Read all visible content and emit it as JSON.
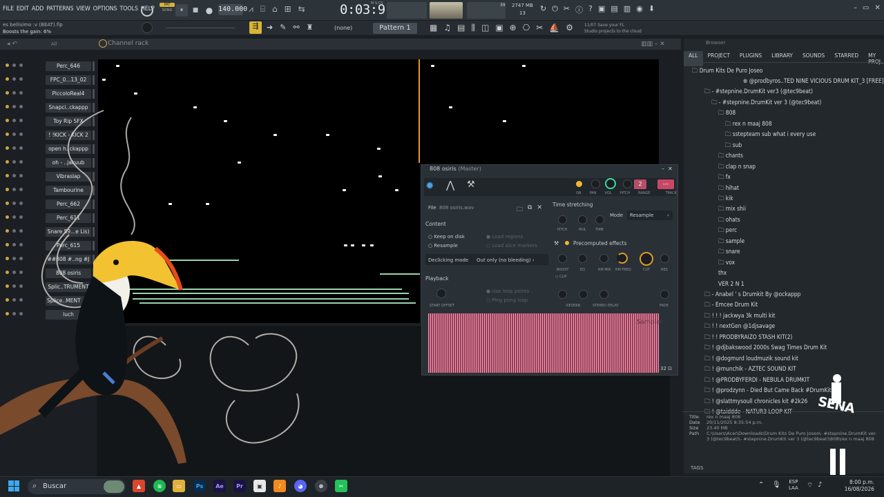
{
  "menu": [
    "FILE",
    "EDIT",
    "ADD",
    "PATTERNS",
    "VIEW",
    "OPTIONS",
    "TOOLS",
    "HELP"
  ],
  "song_mode": "PAT",
  "song_label": "SONG",
  "tempo": "140.000",
  "time": "0:03:91",
  "time_sub": "M:S:CS",
  "cpu_mem": "2747 MB",
  "cpu_cores": "39",
  "cpu_poly": "13",
  "hint_file": "es bellisimo :v (BEAT).flp",
  "hint_text": "Boosts the gain: 6%",
  "pattern_sel": "(none)",
  "pattern": "Pattern 1",
  "news": {
    "date": "11/07",
    "line1": "Save your FL",
    "line2": "Studio projects to the cloud"
  },
  "channel_rack": {
    "title": "Channel rack",
    "filter": "All",
    "channels": [
      "Perc_646",
      "FPC_0...13_02",
      "PiccoloReal4",
      "Snapci..ckappp",
      "Toy Rip SFX",
      "! !KICK - KICK 2",
      "open h..ckappp",
      "oh - ..jakuub",
      "Vibraslap",
      "Tambourine",
      "Perc_662",
      "Perc_611",
      "Snare 59...e Lis)",
      "Perc_615",
      "##808 #..ng #J",
      "808 osiris",
      "Splic..TRUMENT",
      "Splice..MENT #2",
      "luch"
    ]
  },
  "browser": {
    "title": "Browser",
    "tabs": [
      "ALL",
      "PROJECT",
      "PLUGINS",
      "LIBRARY",
      "SOUNDS",
      "STARRED",
      "MY PROJ..."
    ],
    "root": "Drum Kits De Puro Joseo",
    "items": [
      {
        "t": "@prodbyros..TED NINE VICIOUS DRUM KIT_3 [FREE]",
        "d": 4
      },
      {
        "t": "- #stepnine.DrumKit ver3 (@tec9beat)",
        "d": 1
      },
      {
        "t": "- #stepnine.DrumKit ver 3 (@tec9beat)",
        "d": 2
      },
      {
        "t": "808",
        "d": 3
      },
      {
        "t": "rex n maaj 808",
        "d": 4
      },
      {
        "t": "sstepteam sub what i every use",
        "d": 4
      },
      {
        "t": "sub",
        "d": 4
      },
      {
        "t": "chants",
        "d": 3
      },
      {
        "t": "clap n snap",
        "d": 3
      },
      {
        "t": "fx",
        "d": 3
      },
      {
        "t": "hihat",
        "d": 3
      },
      {
        "t": "kik",
        "d": 3
      },
      {
        "t": "mix shii",
        "d": 3
      },
      {
        "t": "ohats",
        "d": 3
      },
      {
        "t": "perc",
        "d": 3
      },
      {
        "t": "sample",
        "d": 3
      },
      {
        "t": "snare",
        "d": 3
      },
      {
        "t": "vox",
        "d": 3
      },
      {
        "t": "thx",
        "d": 3
      },
      {
        "t": "VER 2 N 1",
        "d": 3
      },
      {
        "t": "- Anabel ' s Drumkit By @ockappp",
        "d": 1
      },
      {
        "t": "- Emcee Drum Kit",
        "d": 1
      },
      {
        "t": "! ! ! jackwya 3k multi kit",
        "d": 1
      },
      {
        "t": "! ! nextGen @1djsavage",
        "d": 1
      },
      {
        "t": "! ! PRODBYRAIZO STASH KIT(2)",
        "d": 1
      },
      {
        "t": "! @djbakswood 2000s Swag Times Drum Kit",
        "d": 1
      },
      {
        "t": "! @dogmurd loudmuzik sound kit",
        "d": 1
      },
      {
        "t": "! @munchik - AZTEC SOUND KIT",
        "d": 1
      },
      {
        "t": "! @PRODBYFERDI - NEBULA DRUMKIT",
        "d": 1
      },
      {
        "t": "! @prodzynn - Died But Came Back #DrumKit",
        "d": 1
      },
      {
        "t": "! @slattmysoull chronicles kit #2k26",
        "d": 1
      },
      {
        "t": "! @taiddde - NATUR3 LOOP KIT",
        "d": 1
      }
    ],
    "info": {
      "title_label": "Title",
      "title": "rex n maaj 808",
      "date_label": "Date",
      "date": "20/11/2025 8:35:54 p.m.",
      "size_label": "Size",
      "size": "23.40 MB",
      "path_label": "Path",
      "path1": "C:\\Users\\Acer\\Downloads\\Drum Kits De Puro Joseo\\- #stepnine.DrumKit ver-",
      "path2": "3 (@tec9beat)\\- #stepnine.DrumKit ver 3 (@tec9beat)\\808\\rex n maaj 808"
    },
    "tags": "TAGS"
  },
  "plugin": {
    "title": "808 osiris",
    "title_sub": "(Master)",
    "track": "2",
    "knobs_top": [
      "ON",
      "PAN",
      "VOL",
      "PITCH",
      "RANGE",
      "TRACK"
    ],
    "file_label": "File",
    "file": "808 osiris.wav",
    "content": "Content",
    "keep": "Keep on disk",
    "resample": "Resample",
    "load_regions": "Load regions",
    "load_slice": "Load slice markers",
    "declick_label": "Declicking mode",
    "declick": "Out only (no bleeding)",
    "playback": "Playback",
    "use_loop": "Use loop points",
    "ping_pong": "Ping pong loop",
    "start_offset": "START OFFSET",
    "ts": "Time stretching",
    "ts_knobs": [
      "PITCH",
      "MUL",
      "TIME"
    ],
    "mode_label": "Mode",
    "mode": "Resample",
    "pre": "Precomputed effects",
    "pre_knobs": [
      "BOOST",
      "EQ",
      "RM MIX",
      "RM FREQ",
      "CUT",
      "RES"
    ],
    "clip": "CLIP",
    "reverb": "REVERB",
    "stereo": "STEREO DELAY",
    "fade": "FADE",
    "sampler": "Sampler",
    "zoom": "32"
  },
  "taskbar": {
    "search": "Buscar",
    "lang1": "ESP",
    "lang2": "LAA",
    "time": "8:00 p.m.",
    "date": "16/08/2026"
  },
  "watermark": "SENA"
}
